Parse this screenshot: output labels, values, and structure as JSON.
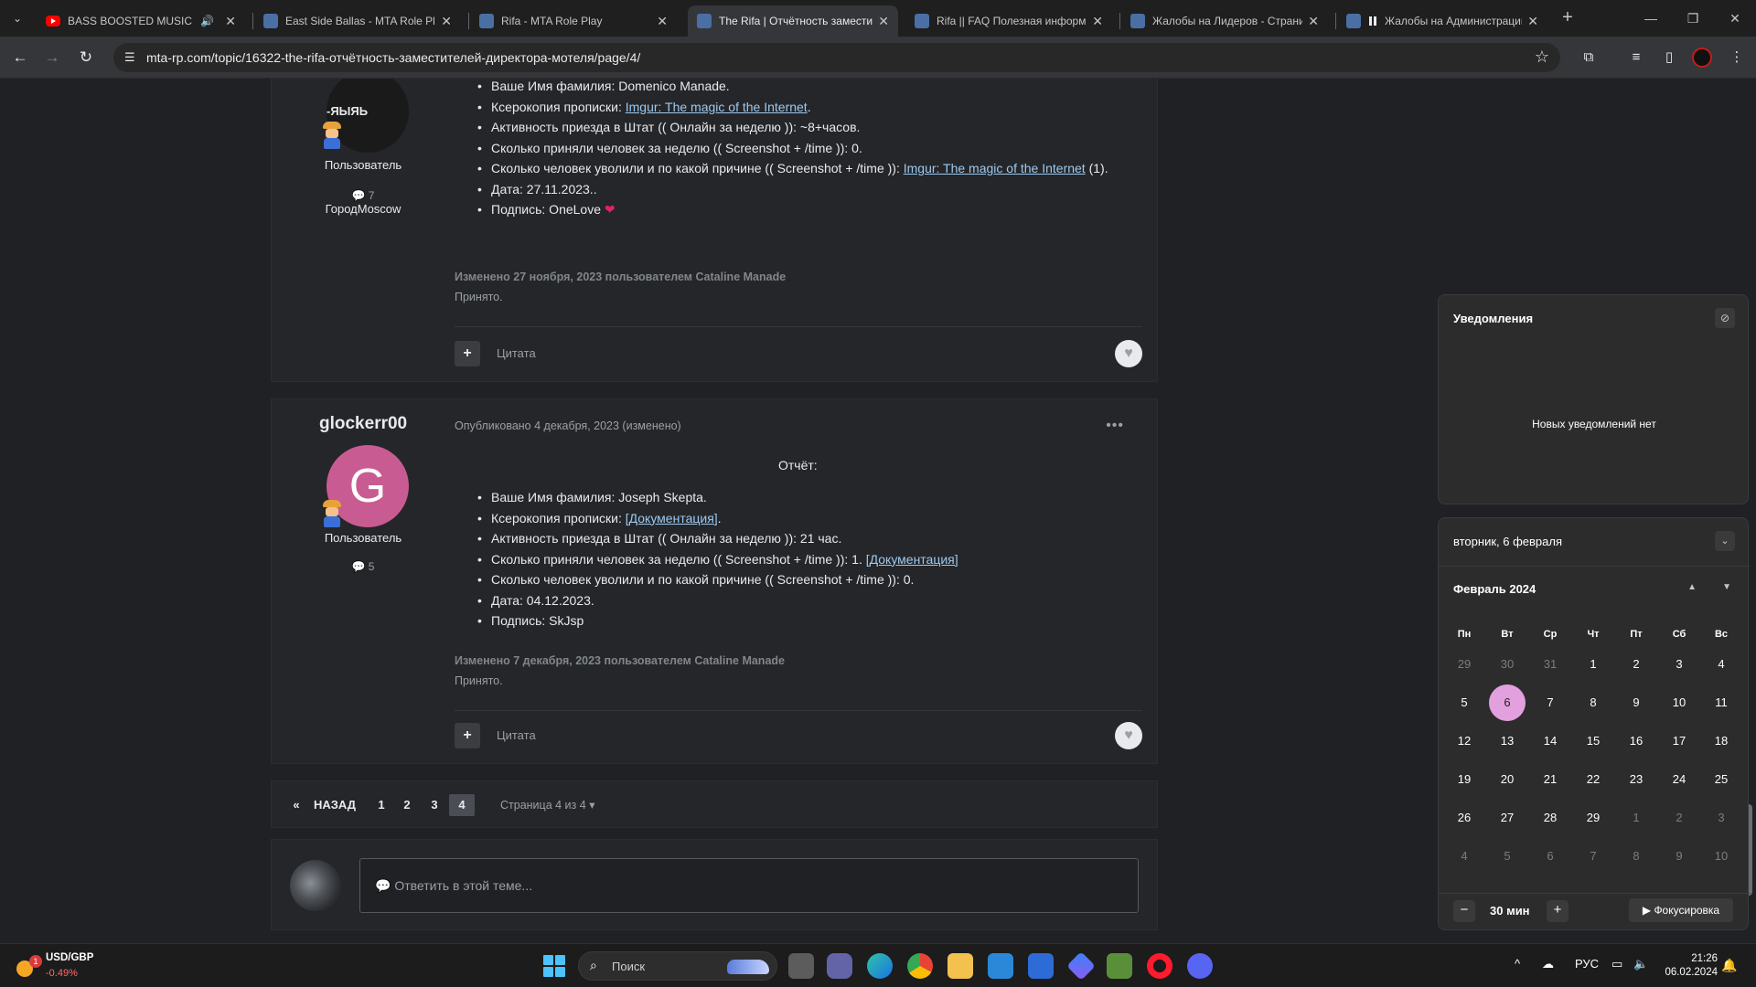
{
  "browser": {
    "tabs": [
      {
        "title": "BASS BOOSTED MUSIC MI",
        "favicon": "youtube-icon",
        "audio": true
      },
      {
        "title": "East Side Ballas - MTA Role Play",
        "favicon": "forum-icon"
      },
      {
        "title": "Rifa - MTA Role Play",
        "favicon": "forum-icon"
      },
      {
        "title": "The Rifa | Отчётность заместит",
        "favicon": "forum-icon",
        "active": true
      },
      {
        "title": "Rifa || FAQ Полезная информа",
        "favicon": "forum-icon"
      },
      {
        "title": "Жалобы на Лидеров - Страни",
        "favicon": "forum-icon"
      },
      {
        "title": "Жалобы на Администрацию",
        "favicon": "pause-icon"
      }
    ],
    "url": "mta-rp.com/topic/16322-the-rifa-отчётность-заместителей-директора-мотеля/page/4/"
  },
  "posts": [
    {
      "author": "",
      "avatar_text": "-ЯЫЯЬ",
      "role": "Пользователь",
      "post_count": "7",
      "city": "ГородMoscow",
      "fields": [
        {
          "label": "Ваше Имя фамилия: Domenico Manade."
        },
        {
          "label": "Ксерокопия прописки: ",
          "link": "Imgur: The magic of the Internet",
          "after": "."
        },
        {
          "label": "Активность приезда в Штат (( Онлайн за неделю )): ~8+часов."
        },
        {
          "label": "Сколько приняли человек за неделю (( Screenshot + /time )): 0."
        },
        {
          "label": "Сколько человек уволили и по какой причине (( Screenshot + /time )):  ",
          "link": "Imgur: The magic of the Internet",
          "after": " (1)."
        },
        {
          "label": "Дата: 27.11.2023.."
        },
        {
          "label": "Подпись: OneLove "
        }
      ],
      "edited": "Изменено 27 ноября, 2023 пользователем Cataline Manade",
      "status": "Принято.",
      "quote_label": "Цитата"
    },
    {
      "author": "glockerr00",
      "avatar_letter": "G",
      "published": "Опубликовано 4 декабря, 2023 (изменено)",
      "heading": "Отчёт:",
      "role": "Пользователь",
      "post_count": "5",
      "fields": [
        {
          "label": "Ваше Имя фамилия: Joseph Skepta."
        },
        {
          "label": "Ксерокопия прописки: ",
          "link": "[Документация]",
          "after": "."
        },
        {
          "label": "Активность приезда в Штат (( Онлайн за неделю )): 21 час."
        },
        {
          "label": "Сколько приняли человек за неделю (( Screenshot + /time )): 1. ",
          "link": "[Документация]",
          "after": ""
        },
        {
          "label": "Сколько человек уволили и по какой причине (( Screenshot + /time )): 0."
        },
        {
          "label": "Дата: 04.12.2023."
        },
        {
          "label": "Подпись: SkJsp"
        }
      ],
      "edited": "Изменено 7 декабря, 2023 пользователем Cataline Manade",
      "status": "Принято.",
      "quote_label": "Цитата"
    }
  ],
  "pagination": {
    "prev_label": "НАЗАД",
    "pages": [
      "1",
      "2",
      "3",
      "4"
    ],
    "current": "4",
    "info": "Страница 4 из 4"
  },
  "reply": {
    "placeholder": "Ответить в этой теме..."
  },
  "notifications": {
    "title": "Уведомления",
    "empty": "Новых уведомлений нет"
  },
  "calendar": {
    "date_header": "вторник, 6 февраля",
    "month": "Февраль 2024",
    "weekdays": [
      "Пн",
      "Вт",
      "Ср",
      "Чт",
      "Пт",
      "Сб",
      "Вс"
    ],
    "weeks": [
      [
        "29",
        "30",
        "31",
        "1",
        "2",
        "3",
        "4"
      ],
      [
        "5",
        "6",
        "7",
        "8",
        "9",
        "10",
        "11"
      ],
      [
        "12",
        "13",
        "14",
        "15",
        "16",
        "17",
        "18"
      ],
      [
        "19",
        "20",
        "21",
        "22",
        "23",
        "24",
        "25"
      ],
      [
        "26",
        "27",
        "28",
        "29",
        "1",
        "2",
        "3"
      ],
      [
        "4",
        "5",
        "6",
        "7",
        "8",
        "9",
        "10"
      ]
    ],
    "today": "6",
    "focus_minutes": "30 мин",
    "focus_label": "Фокусировка"
  },
  "taskbar": {
    "ticker": "USD/GBP",
    "ticker_change": "-0.49%",
    "weather_badge": "1",
    "search_placeholder": "Поиск",
    "language": "РУС",
    "time": "21:26",
    "date": "06.02.2024"
  }
}
